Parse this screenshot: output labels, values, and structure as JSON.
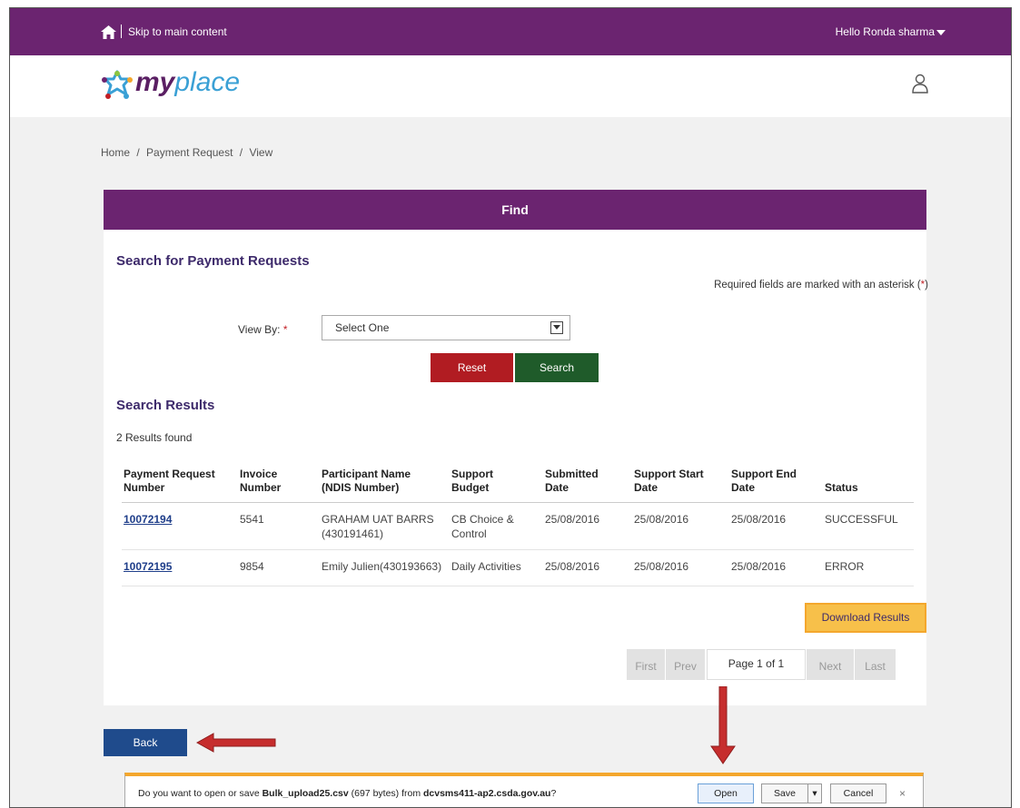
{
  "topbar": {
    "skip_label": "Skip to main content",
    "greeting": "Hello Ronda sharma",
    "bg_color": "#6b2470"
  },
  "header": {
    "logo_my": "my",
    "logo_place": "place"
  },
  "breadcrumb": {
    "items": [
      "Home",
      "/",
      "Payment Request",
      "/",
      "View"
    ]
  },
  "find": {
    "title": "Find",
    "section_title": "Search for Payment Requests",
    "required_text": "Required fields are marked with an asterisk (",
    "required_ast": "*",
    "required_close": ")",
    "viewby_label": "View By:",
    "viewby_ast": "*",
    "viewby_value": "Select One",
    "reset_label": "Reset",
    "search_label": "Search"
  },
  "results": {
    "title": "Search Results",
    "count_text": "2 Results found",
    "columns": [
      [
        "Payment Request",
        "Number"
      ],
      [
        "Invoice",
        "Number"
      ],
      [
        "Participant Name",
        "(NDIS Number)"
      ],
      [
        "Support",
        "Budget"
      ],
      [
        "Submitted",
        "Date"
      ],
      [
        "Support Start",
        "Date"
      ],
      [
        "Support End",
        "Date"
      ],
      [
        "",
        "Status"
      ]
    ],
    "rows": [
      {
        "request_number": "10072194",
        "invoice": "5541",
        "participant_line1": "GRAHAM UAT BARRS",
        "participant_line2": "(430191461)",
        "budget_line1": "CB Choice &",
        "budget_line2": "Control",
        "submitted": "25/08/2016",
        "start": "25/08/2016",
        "end": "25/08/2016",
        "status": "SUCCESSFUL"
      },
      {
        "request_number": "10072195",
        "invoice": "9854",
        "participant_line1": "Emily Julien(430193663)",
        "participant_line2": "",
        "budget_line1": "Daily Activities",
        "budget_line2": "",
        "submitted": "25/08/2016",
        "start": "25/08/2016",
        "end": "25/08/2016",
        "status": "ERROR"
      }
    ],
    "download_label": "Download Results",
    "pager": {
      "first": "First",
      "prev": "Prev",
      "current": "Page 1 of 1",
      "next": "Next",
      "last": "Last"
    }
  },
  "back_label": "Back",
  "notification": {
    "prefix": "Do you want to open or save ",
    "filename": "Bulk_upload25.csv",
    "middle": " (697 bytes) from ",
    "host": "dcvsms411-ap2.csda.gov.au",
    "suffix": "?",
    "open_label": "Open",
    "save_label": "Save",
    "cancel_label": "Cancel",
    "close_glyph": "×"
  }
}
